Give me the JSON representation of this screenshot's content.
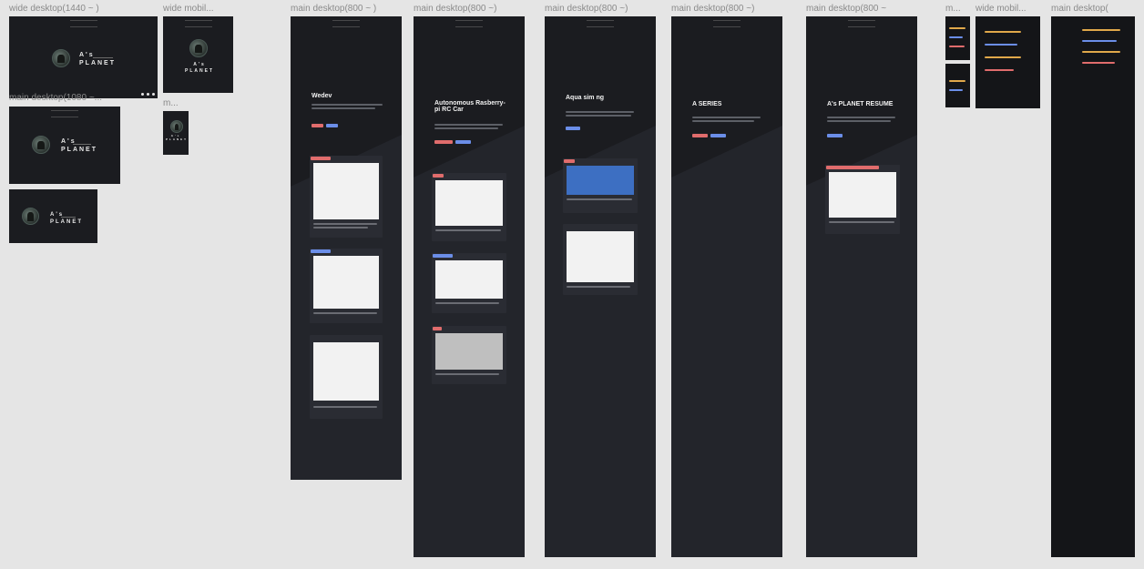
{
  "frames": {
    "wide_desktop_1440": {
      "label": "wide desktop(1440 ~ )",
      "planet": "A's PLANET"
    },
    "wide_mobile_1": {
      "label": "wide mobil...",
      "planet": "A's PLANET"
    },
    "main_desktop_1080": {
      "label": "main desktop(1080 ~...",
      "planet": "A's PLANET"
    },
    "small_desktop": {
      "label": "",
      "planet": "A's PLANET"
    },
    "mobile_small": {
      "label": "m...",
      "planet": "A's PLANET"
    },
    "wedev": {
      "label": "main desktop(800 ~ )",
      "title": "Wedev"
    },
    "rc_car": {
      "label": "main desktop(800 ~)",
      "title": "Autonomous Rasberry-pi RC Car"
    },
    "aqua": {
      "label": "main desktop(800 ~)",
      "title": "Aqua sim ng"
    },
    "a_series": {
      "label": "main desktop(800 ~)",
      "title": "A SERIES"
    },
    "resume": {
      "label": "main desktop(800 ~",
      "title": "A's PLANET RESUME"
    },
    "timeline_m": {
      "label": "m..."
    },
    "timeline_wide": {
      "label": "wide mobil..."
    },
    "timeline_main": {
      "label": "main desktop("
    }
  },
  "colors": {
    "canvas": "#e5e5e5",
    "frame": "#1b1c20",
    "accent_red": "#e06c6c",
    "accent_blue": "#6b8ee8"
  }
}
